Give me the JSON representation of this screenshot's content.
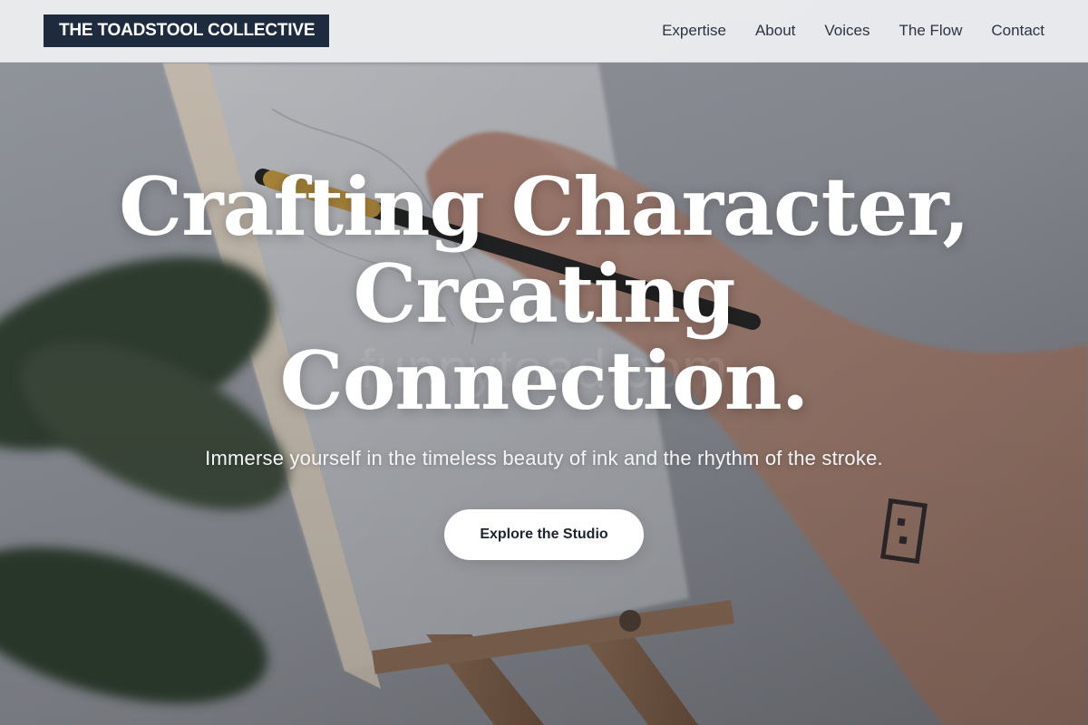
{
  "header": {
    "logo_text": "THE TOADSTOOL COLLECTIVE",
    "nav": [
      {
        "label": "Expertise"
      },
      {
        "label": "About"
      },
      {
        "label": "Voices"
      },
      {
        "label": "The Flow"
      },
      {
        "label": "Contact"
      }
    ]
  },
  "hero": {
    "title_lines": [
      "Crafting Character,",
      "Creating",
      "Connection."
    ],
    "subtitle": "Immerse yourself in the timeless beauty of ink and the rhythm of the stroke.",
    "cta_label": "Explore the Studio",
    "watermark": "funnytoad.com",
    "background_image": "artist-painting-canvas-on-easel"
  },
  "colors": {
    "logo_bg": "#1e2a3d",
    "header_bg": "#ecedef",
    "nav_text": "#2b3445",
    "hero_text": "#ffffff",
    "cta_bg": "#ffffff",
    "cta_text": "#1d2430"
  }
}
